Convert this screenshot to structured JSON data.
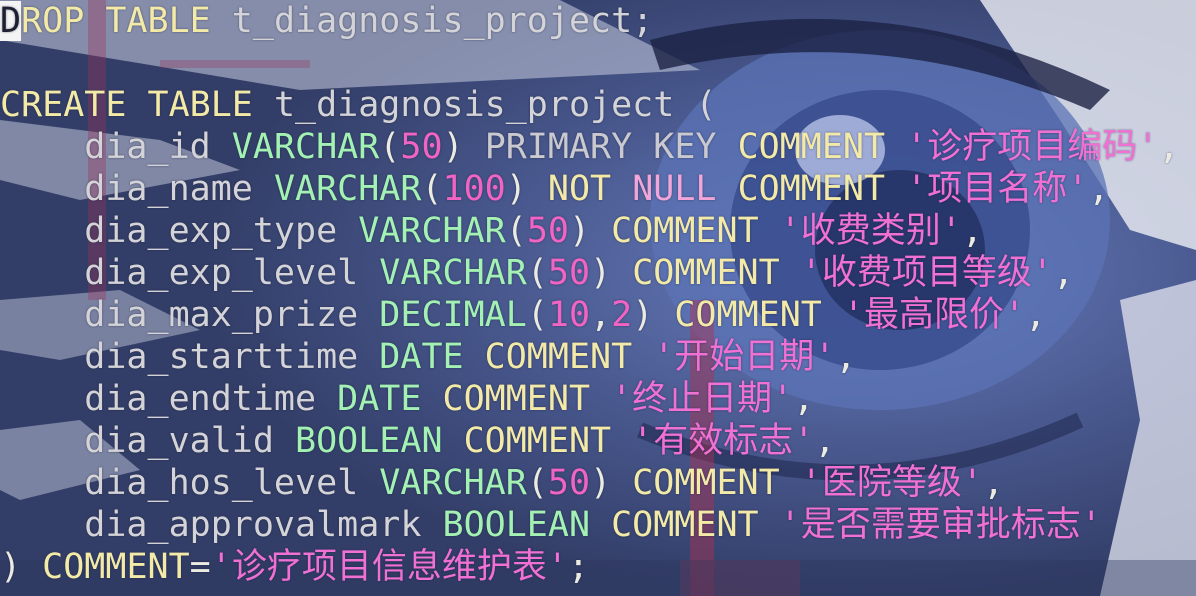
{
  "editor": {
    "lines": [
      [
        {
          "t": "D",
          "c": "cursor"
        },
        {
          "t": "ROP TABLE ",
          "c": "kw"
        },
        {
          "t": "t_diagnosis_project;",
          "c": "id"
        }
      ],
      [],
      [
        {
          "t": "CREATE TABLE ",
          "c": "kw"
        },
        {
          "t": "t_diagnosis_project (",
          "c": "id"
        }
      ],
      [
        {
          "t": "    dia_id ",
          "c": "id"
        },
        {
          "t": "VARCHAR",
          "c": "ty"
        },
        {
          "t": "(",
          "c": "pn"
        },
        {
          "t": "50",
          "c": "num"
        },
        {
          "t": ") ",
          "c": "pn"
        },
        {
          "t": "PRIMARY KEY ",
          "c": "pk"
        },
        {
          "t": "COMMENT ",
          "c": "kw"
        },
        {
          "t": "'诊疗项目编码'",
          "c": "str"
        },
        {
          "t": ",",
          "c": "pn"
        }
      ],
      [
        {
          "t": "    dia_name ",
          "c": "id"
        },
        {
          "t": "VARCHAR",
          "c": "ty"
        },
        {
          "t": "(",
          "c": "pn"
        },
        {
          "t": "100",
          "c": "num"
        },
        {
          "t": ") ",
          "c": "pn"
        },
        {
          "t": "NOT ",
          "c": "kw"
        },
        {
          "t": "NULL ",
          "c": "nn"
        },
        {
          "t": "COMMENT ",
          "c": "kw"
        },
        {
          "t": "'项目名称'",
          "c": "str"
        },
        {
          "t": ",",
          "c": "pn"
        }
      ],
      [
        {
          "t": "    dia_exp_type ",
          "c": "id"
        },
        {
          "t": "VARCHAR",
          "c": "ty"
        },
        {
          "t": "(",
          "c": "pn"
        },
        {
          "t": "50",
          "c": "num"
        },
        {
          "t": ") ",
          "c": "pn"
        },
        {
          "t": "COMMENT ",
          "c": "kw"
        },
        {
          "t": "'收费类别'",
          "c": "str"
        },
        {
          "t": ",",
          "c": "pn"
        }
      ],
      [
        {
          "t": "    dia_exp_level ",
          "c": "id"
        },
        {
          "t": "VARCHAR",
          "c": "ty"
        },
        {
          "t": "(",
          "c": "pn"
        },
        {
          "t": "50",
          "c": "num"
        },
        {
          "t": ") ",
          "c": "pn"
        },
        {
          "t": "COMMENT ",
          "c": "kw"
        },
        {
          "t": "'收费项目等级'",
          "c": "str"
        },
        {
          "t": ",",
          "c": "pn"
        }
      ],
      [
        {
          "t": "    dia_max_prize ",
          "c": "id"
        },
        {
          "t": "DECIMAL",
          "c": "ty"
        },
        {
          "t": "(",
          "c": "pn"
        },
        {
          "t": "10",
          "c": "num"
        },
        {
          "t": ",",
          "c": "pn"
        },
        {
          "t": "2",
          "c": "num"
        },
        {
          "t": ") ",
          "c": "pn"
        },
        {
          "t": "COMMENT ",
          "c": "kw"
        },
        {
          "t": "'最高限价'",
          "c": "str"
        },
        {
          "t": ",",
          "c": "pn"
        }
      ],
      [
        {
          "t": "    dia_starttime ",
          "c": "id"
        },
        {
          "t": "DATE ",
          "c": "ty"
        },
        {
          "t": "COMMENT ",
          "c": "kw"
        },
        {
          "t": "'开始日期'",
          "c": "str"
        },
        {
          "t": ",",
          "c": "pn"
        }
      ],
      [
        {
          "t": "    dia_endtime ",
          "c": "id"
        },
        {
          "t": "DATE ",
          "c": "ty"
        },
        {
          "t": "COMMENT ",
          "c": "kw"
        },
        {
          "t": "'终止日期'",
          "c": "str"
        },
        {
          "t": ",",
          "c": "pn"
        }
      ],
      [
        {
          "t": "    dia_valid ",
          "c": "id"
        },
        {
          "t": "BOOLEAN ",
          "c": "ty"
        },
        {
          "t": "COMMENT ",
          "c": "kw"
        },
        {
          "t": "'有效标志'",
          "c": "str"
        },
        {
          "t": ",",
          "c": "pn"
        }
      ],
      [
        {
          "t": "    dia_hos_level ",
          "c": "id"
        },
        {
          "t": "VARCHAR",
          "c": "ty"
        },
        {
          "t": "(",
          "c": "pn"
        },
        {
          "t": "50",
          "c": "num"
        },
        {
          "t": ") ",
          "c": "pn"
        },
        {
          "t": "COMMENT ",
          "c": "kw"
        },
        {
          "t": "'医院等级'",
          "c": "str"
        },
        {
          "t": ",",
          "c": "pn"
        }
      ],
      [
        {
          "t": "    dia_approvalmark ",
          "c": "id"
        },
        {
          "t": "BOOLEAN ",
          "c": "ty"
        },
        {
          "t": "COMMENT ",
          "c": "kw"
        },
        {
          "t": "'是否需要审批标志'",
          "c": "str"
        }
      ],
      [
        {
          "t": ") ",
          "c": "pn"
        },
        {
          "t": "COMMENT",
          "c": "kw"
        },
        {
          "t": "=",
          "c": "pn"
        },
        {
          "t": "'诊疗项目信息维护表'",
          "c": "str"
        },
        {
          "t": ";",
          "c": "pn"
        }
      ]
    ]
  },
  "colors": {
    "keyword": "#f3eaa8",
    "type": "#a3f2b4",
    "number": "#f264c4",
    "string": "#f070d4",
    "identifier": "#d4d4d8",
    "background": "#3c4a78"
  }
}
